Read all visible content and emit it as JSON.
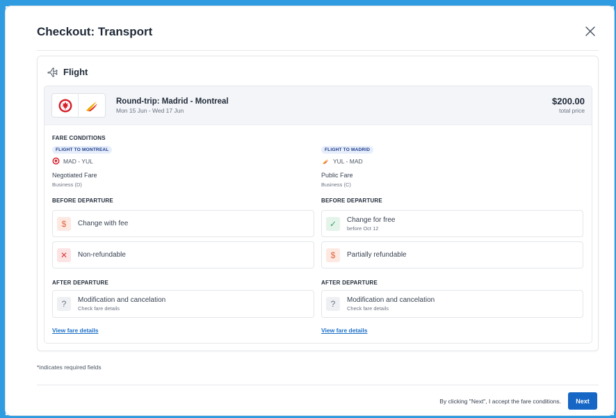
{
  "modal": {
    "title": "Checkout: Transport",
    "close_icon": "close-icon"
  },
  "flight": {
    "section_title": "Flight",
    "icon": "plane-icon",
    "route_title": "Round-trip: Madrid - Montreal",
    "dates": "Mon 15 Jun - Wed 17 Jun",
    "price": "$200.00",
    "price_label": "total price",
    "airlines": [
      "air-canada-logo",
      "iberia-logo"
    ]
  },
  "fare_conditions": {
    "label": "FARE CONDITIONS",
    "legs": [
      {
        "badge": "FLIGHT TO MONTREAL",
        "route": "MAD - YUL",
        "airline_logo": "air-canada-logo",
        "fare_name": "Negotiated Fare",
        "fare_class": "Business (D)",
        "before_label": "BEFORE DEPARTURE",
        "before": [
          {
            "icon": "dollar-icon",
            "status": "fee",
            "text": "Change with fee",
            "sub": ""
          },
          {
            "icon": "x-icon",
            "status": "no",
            "text": "Non-refundable",
            "sub": ""
          }
        ],
        "after_label": "AFTER DEPARTURE",
        "after": [
          {
            "icon": "question-icon",
            "status": "q",
            "text": "Modification and cancelation",
            "sub": "Check fare details"
          }
        ],
        "link": "View fare details"
      },
      {
        "badge": "FLIGHT TO MADRID",
        "route": "YUL - MAD",
        "airline_logo": "iberia-logo",
        "fare_name": "Public Fare",
        "fare_class": "Business (C)",
        "before_label": "BEFORE DEPARTURE",
        "before": [
          {
            "icon": "check-icon",
            "status": "free",
            "text": "Change for free",
            "sub": "before Oct 12"
          },
          {
            "icon": "dollar-icon",
            "status": "fee",
            "text": "Partially refundable",
            "sub": ""
          }
        ],
        "after_label": "AFTER DEPARTURE",
        "after": [
          {
            "icon": "question-icon",
            "status": "q",
            "text": "Modification and cancelation",
            "sub": "Check fare details"
          }
        ],
        "link": "View fare details"
      }
    ]
  },
  "footer": {
    "required_note": "*indicates required fields",
    "accept_text": "By clicking \"Next\", I accept the fare conditions.",
    "next_label": "Next"
  },
  "colors": {
    "accent": "#1666c6",
    "frame": "#2f9be0",
    "link": "#1a6fc9"
  }
}
